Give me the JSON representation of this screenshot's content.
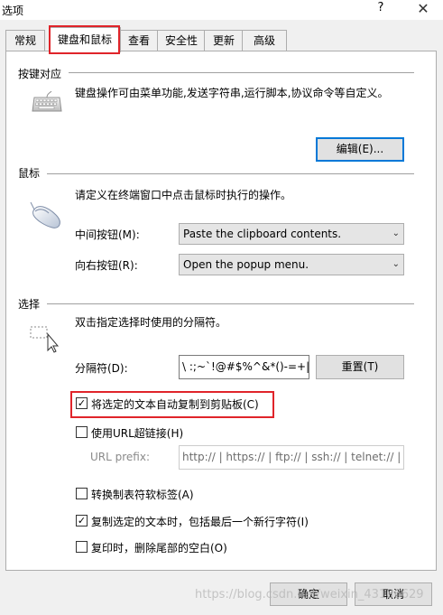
{
  "window": {
    "title": "选项",
    "help": "?",
    "close": "✕"
  },
  "tabs": [
    "常规",
    "键盘和鼠标",
    "查看",
    "安全性",
    "更新",
    "高级"
  ],
  "keyboard": {
    "section": "按键对应",
    "description": "键盘操作可由菜单功能,发送字符串,运行脚本,协议命令等自定义。",
    "edit_button": "编辑(E)..."
  },
  "mouse": {
    "section": "鼠标",
    "description": "请定义在终端窗口中点击鼠标时执行的操作。",
    "middle_label": "中间按钮(M):",
    "middle_value": "Paste the clipboard contents.",
    "right_label": "向右按钮(R):",
    "right_value": "Open the popup menu."
  },
  "selection": {
    "section": "选择",
    "description": "双击指定选择时使用的分隔符。",
    "delimiter_label": "分隔符(D):",
    "delimiter_value": "\\ :;~`!@#$%^&*()-=+|[]{}",
    "reset_button": "重置(T)",
    "auto_copy_label": "将选定的文本自动复制到剪贴板(C)",
    "auto_copy_checked": true,
    "url_link_label": "使用URL超链接(H)",
    "url_link_checked": false,
    "url_prefix_label": "URL prefix:",
    "url_prefix_value": "http:// | https:// | ftp:// | ssh:// | telnet:// |",
    "tab_to_space_label": "转换制表符软标签(A)",
    "tab_to_space_checked": false,
    "copy_newline_label": "复制选定的文本时，包括最后一个新行字符(I)",
    "copy_newline_checked": true,
    "trim_trailing_label": "复印时，删除尾部的空白(O)",
    "trim_trailing_checked": false
  },
  "footer": {
    "ok": "确定",
    "cancel": "取消"
  },
  "watermark": "https://blog.csdn.net/weixin_43186629"
}
